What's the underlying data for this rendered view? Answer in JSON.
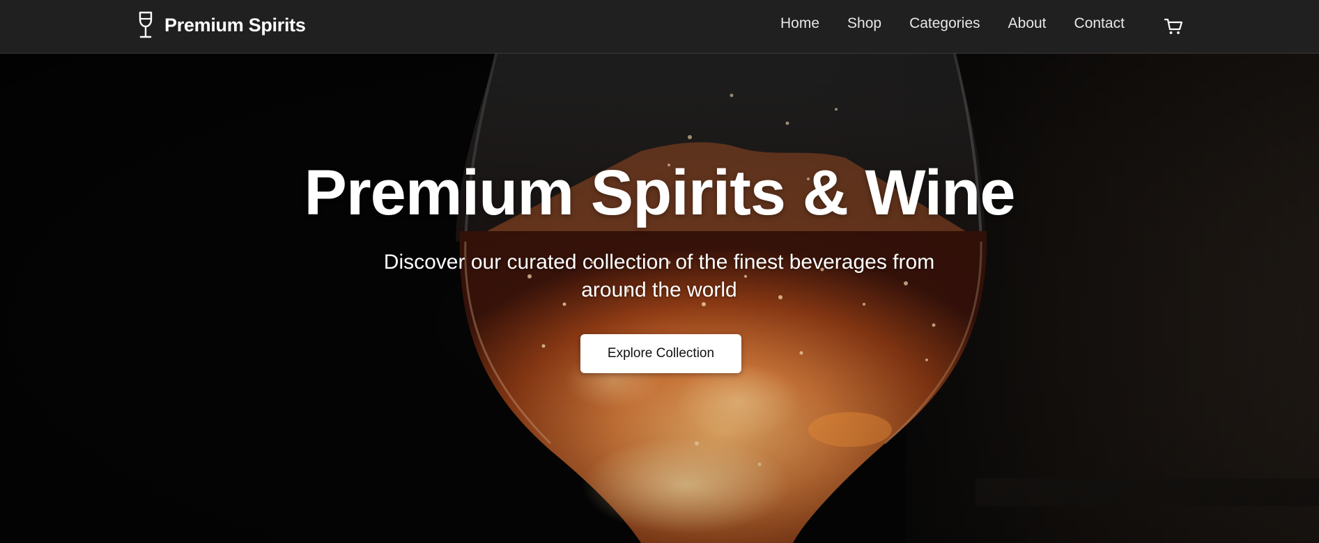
{
  "header": {
    "brand_name": "Premium Spirits",
    "brand_icon": "wine-glass-icon",
    "nav": [
      {
        "label": "Home"
      },
      {
        "label": "Shop"
      },
      {
        "label": "Categories"
      },
      {
        "label": "About"
      },
      {
        "label": "Contact"
      }
    ],
    "cart_icon": "shopping-cart-icon"
  },
  "hero": {
    "title": "Premium Spirits & Wine",
    "subtitle": "Discover our curated collection of the finest beverages from around the world",
    "cta_label": "Explore Collection",
    "background": "wine glass photo"
  },
  "colors": {
    "header_bg": "#121212",
    "text": "#ffffff",
    "cta_bg": "#ffffff",
    "cta_text": "#111111",
    "liquid": "#c0622a"
  }
}
